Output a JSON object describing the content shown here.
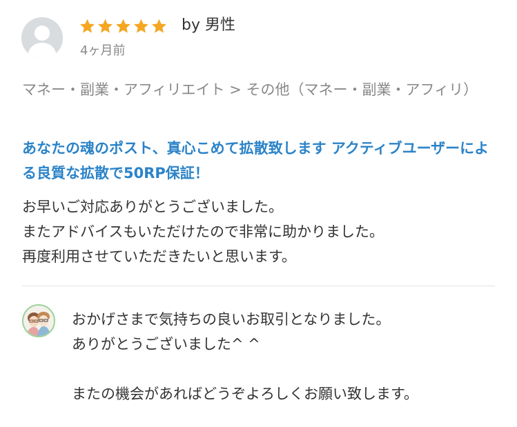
{
  "review": {
    "reviewer_avatar_icon": "default-user-avatar-icon",
    "rating": 5,
    "rating_max": 5,
    "star_color": "#f5a623",
    "byline": "by 男性",
    "date": "4ヶ月前",
    "category": "マネー・副業・アフィリエイト > その他（マネー・副業・アフィリ）",
    "service_title": "あなたの魂のポスト、真心こめて拡散致します アクティブユーザーによる良質な拡散で50RP保証！",
    "title_color": "#2b83c8",
    "body_lines": [
      "お早いご対応ありがとうございました。",
      "またアドバイスもいただけたので非常に助かりました。",
      "再度利用させていただきたいと思います。"
    ]
  },
  "reply": {
    "seller_avatar_icon": "seller-illustration-avatar-icon",
    "body_lines": [
      "おかげさまで気持ちの良いお取引となりました。",
      "ありがとうございました^ ^",
      "",
      "またの機会があればどうぞよろしくお願い致します。"
    ]
  }
}
